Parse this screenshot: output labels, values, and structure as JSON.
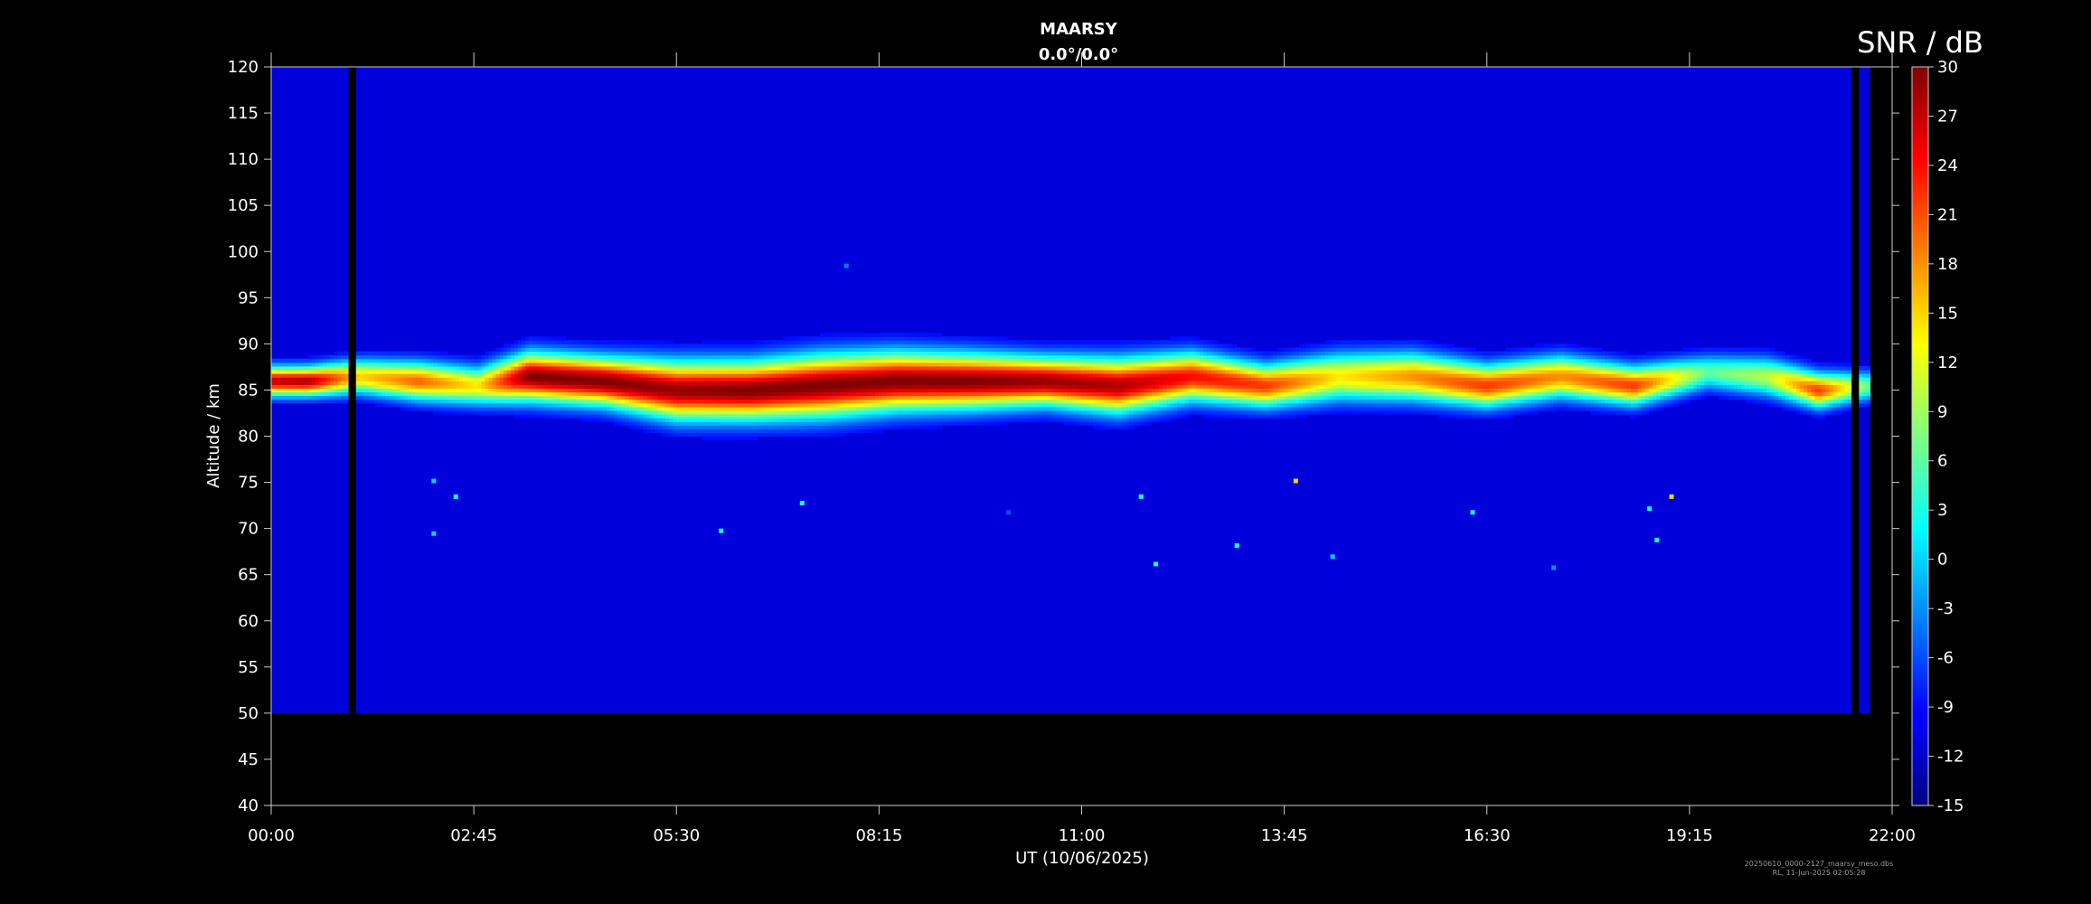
{
  "chart_data": {
    "type": "heatmap",
    "title": "MAARSY",
    "subtitle": "0.0°/0.0°",
    "xlabel": "UT (10/06/2025)",
    "ylabel": "Altitude / km",
    "x_tick_labels": [
      "00:00",
      "02:45",
      "05:30",
      "08:15",
      "11:00",
      "13:45",
      "16:30",
      "19:15",
      "22:00"
    ],
    "x_range_hours": [
      0,
      22
    ],
    "y_ticks": [
      40,
      45,
      50,
      55,
      60,
      65,
      70,
      75,
      80,
      85,
      90,
      95,
      100,
      105,
      110,
      115,
      120
    ],
    "ylim": [
      40,
      120
    ],
    "data_altitude_range": [
      50,
      120
    ],
    "data_time_range_hours": [
      0,
      21.7
    ],
    "colorbar": {
      "label": "SNR / dB",
      "range": [
        -15,
        30
      ],
      "ticks": [
        30,
        27,
        24,
        21,
        18,
        15,
        12,
        9,
        6,
        3,
        0,
        -3,
        -6,
        -9,
        -12,
        -15
      ],
      "colormap": "jet"
    },
    "background_snr_db": -11,
    "data_gaps_hours": [
      [
        1.05,
        1.15
      ],
      [
        21.45,
        21.55
      ]
    ],
    "echo_layer": [
      {
        "t": 0.0,
        "center_km": 86.0,
        "half_width_km": 1.5,
        "peak_snr_db": 27
      },
      {
        "t": 0.5,
        "center_km": 86.0,
        "half_width_km": 1.5,
        "peak_snr_db": 28
      },
      {
        "t": 1.2,
        "center_km": 86.5,
        "half_width_km": 1.8,
        "peak_snr_db": 15
      },
      {
        "t": 2.0,
        "center_km": 86.0,
        "half_width_km": 2.0,
        "peak_snr_db": 20
      },
      {
        "t": 2.8,
        "center_km": 85.5,
        "half_width_km": 2.0,
        "peak_snr_db": 14
      },
      {
        "t": 3.5,
        "center_km": 86.5,
        "half_width_km": 2.5,
        "peak_snr_db": 30
      },
      {
        "t": 4.5,
        "center_km": 86.0,
        "half_width_km": 2.5,
        "peak_snr_db": 30
      },
      {
        "t": 5.5,
        "center_km": 85.0,
        "half_width_km": 3.0,
        "peak_snr_db": 29
      },
      {
        "t": 6.5,
        "center_km": 85.0,
        "half_width_km": 3.0,
        "peak_snr_db": 30
      },
      {
        "t": 7.5,
        "center_km": 85.5,
        "half_width_km": 3.2,
        "peak_snr_db": 30
      },
      {
        "t": 8.5,
        "center_km": 86.0,
        "half_width_km": 3.0,
        "peak_snr_db": 30
      },
      {
        "t": 9.5,
        "center_km": 86.0,
        "half_width_km": 2.8,
        "peak_snr_db": 30
      },
      {
        "t": 10.5,
        "center_km": 86.0,
        "half_width_km": 2.5,
        "peak_snr_db": 29
      },
      {
        "t": 11.5,
        "center_km": 85.5,
        "half_width_km": 2.8,
        "peak_snr_db": 28
      },
      {
        "t": 12.5,
        "center_km": 86.5,
        "half_width_km": 2.5,
        "peak_snr_db": 24
      },
      {
        "t": 13.5,
        "center_km": 85.5,
        "half_width_km": 2.2,
        "peak_snr_db": 22
      },
      {
        "t": 14.5,
        "center_km": 86.5,
        "half_width_km": 2.5,
        "peak_snr_db": 14
      },
      {
        "t": 15.5,
        "center_km": 86.5,
        "half_width_km": 2.5,
        "peak_snr_db": 18
      },
      {
        "t": 16.5,
        "center_km": 85.5,
        "half_width_km": 2.2,
        "peak_snr_db": 22
      },
      {
        "t": 17.5,
        "center_km": 86.5,
        "half_width_km": 2.2,
        "peak_snr_db": 18
      },
      {
        "t": 18.5,
        "center_km": 85.5,
        "half_width_km": 2.0,
        "peak_snr_db": 22
      },
      {
        "t": 19.5,
        "center_km": 87.0,
        "half_width_km": 1.8,
        "peak_snr_db": 6
      },
      {
        "t": 20.3,
        "center_km": 86.5,
        "half_width_km": 2.0,
        "peak_snr_db": 10
      },
      {
        "t": 21.0,
        "center_km": 85.0,
        "half_width_km": 1.8,
        "peak_snr_db": 22
      },
      {
        "t": 21.7,
        "center_km": 85.5,
        "half_width_km": 1.5,
        "peak_snr_db": 6
      }
    ],
    "isolated_echoes": [
      {
        "t": 7.8,
        "alt_km": 98.5,
        "snr_db": -4
      },
      {
        "t": 2.2,
        "alt_km": 75.2,
        "snr_db": 0
      },
      {
        "t": 2.5,
        "alt_km": 73.5,
        "snr_db": 3
      },
      {
        "t": 2.2,
        "alt_km": 69.5,
        "snr_db": 0
      },
      {
        "t": 6.1,
        "alt_km": 69.8,
        "snr_db": 3
      },
      {
        "t": 7.2,
        "alt_km": 72.8,
        "snr_db": 3
      },
      {
        "t": 10.0,
        "alt_km": 71.8,
        "snr_db": -6
      },
      {
        "t": 11.8,
        "alt_km": 73.5,
        "snr_db": 3
      },
      {
        "t": 12.0,
        "alt_km": 66.2,
        "snr_db": 3
      },
      {
        "t": 13.9,
        "alt_km": 75.2,
        "snr_db": 15
      },
      {
        "t": 13.1,
        "alt_km": 68.2,
        "snr_db": 3
      },
      {
        "t": 14.4,
        "alt_km": 67.0,
        "snr_db": 0
      },
      {
        "t": 16.3,
        "alt_km": 71.8,
        "snr_db": 3
      },
      {
        "t": 17.4,
        "alt_km": 65.8,
        "snr_db": -3
      },
      {
        "t": 18.7,
        "alt_km": 72.2,
        "snr_db": 3
      },
      {
        "t": 18.8,
        "alt_km": 68.8,
        "snr_db": 3
      },
      {
        "t": 19.0,
        "alt_km": 73.5,
        "snr_db": 15
      }
    ]
  },
  "footer": {
    "line1": "20250610_0000-2127_maarsy_meso.dbs",
    "line2": "RL, 11-Jun-2025 02:05:28"
  }
}
